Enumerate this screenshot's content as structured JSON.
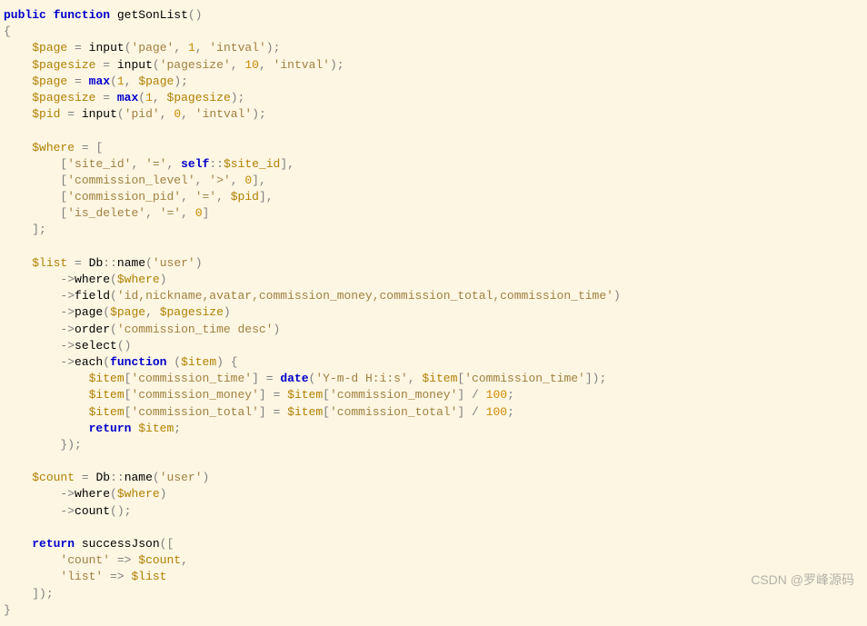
{
  "code": {
    "l1": {
      "kw1": "public",
      "kw2": "function",
      "name": "getSonList",
      "paren": "()"
    },
    "l3": {
      "v1": "$page",
      "f": "input",
      "s1": "'page'",
      "n1": "1",
      "s2": "'intval'"
    },
    "l4": {
      "v1": "$pagesize",
      "f": "input",
      "s1": "'pagesize'",
      "n1": "10",
      "s2": "'intval'"
    },
    "l5": {
      "v1": "$page",
      "f": "max",
      "n1": "1",
      "v2": "$page"
    },
    "l6": {
      "v1": "$pagesize",
      "f": "max",
      "n1": "1",
      "v2": "$pagesize"
    },
    "l7": {
      "v1": "$pid",
      "f": "input",
      "s1": "'pid'",
      "n1": "0",
      "s2": "'intval'"
    },
    "l9": {
      "v1": "$where"
    },
    "l10": {
      "s1": "'site_id'",
      "s2": "'='",
      "kw": "self",
      "p": "$site_id"
    },
    "l11": {
      "s1": "'commission_level'",
      "s2": "'>'",
      "n": "0"
    },
    "l12": {
      "s1": "'commission_pid'",
      "s2": "'='",
      "v": "$pid"
    },
    "l13": {
      "s1": "'is_delete'",
      "s2": "'='",
      "n": "0"
    },
    "l16": {
      "v": "$list",
      "cls": "Db",
      "m": "name",
      "s": "'user'"
    },
    "l17": {
      "m": "where",
      "v": "$where"
    },
    "l18": {
      "m": "field",
      "s": "'id,nickname,avatar,commission_money,commission_total,commission_time'"
    },
    "l19": {
      "m": "page",
      "v1": "$page",
      "v2": "$pagesize"
    },
    "l20": {
      "m": "order",
      "s": "'commission_time desc'"
    },
    "l21": {
      "m": "select"
    },
    "l22": {
      "m": "each",
      "kw": "function",
      "v": "$item"
    },
    "l23": {
      "v1": "$item",
      "k1": "'commission_time'",
      "f": "date",
      "s": "'Y-m-d H:i:s'",
      "v2": "$item",
      "k2": "'commission_time'"
    },
    "l24": {
      "v1": "$item",
      "k1": "'commission_money'",
      "v2": "$item",
      "k2": "'commission_money'",
      "n": "100"
    },
    "l25": {
      "v1": "$item",
      "k1": "'commission_total'",
      "v2": "$item",
      "k2": "'commission_total'",
      "n": "100"
    },
    "l26": {
      "kw": "return",
      "v": "$item"
    },
    "l29": {
      "v": "$count",
      "cls": "Db",
      "m": "name",
      "s": "'user'"
    },
    "l30": {
      "m": "where",
      "v": "$where"
    },
    "l31": {
      "m": "count"
    },
    "l33": {
      "kw": "return",
      "f": "successJson"
    },
    "l34": {
      "s": "'count'",
      "v": "$count"
    },
    "l35": {
      "s": "'list'",
      "v": "$list"
    }
  },
  "watermark": "CSDN @罗峰源码"
}
